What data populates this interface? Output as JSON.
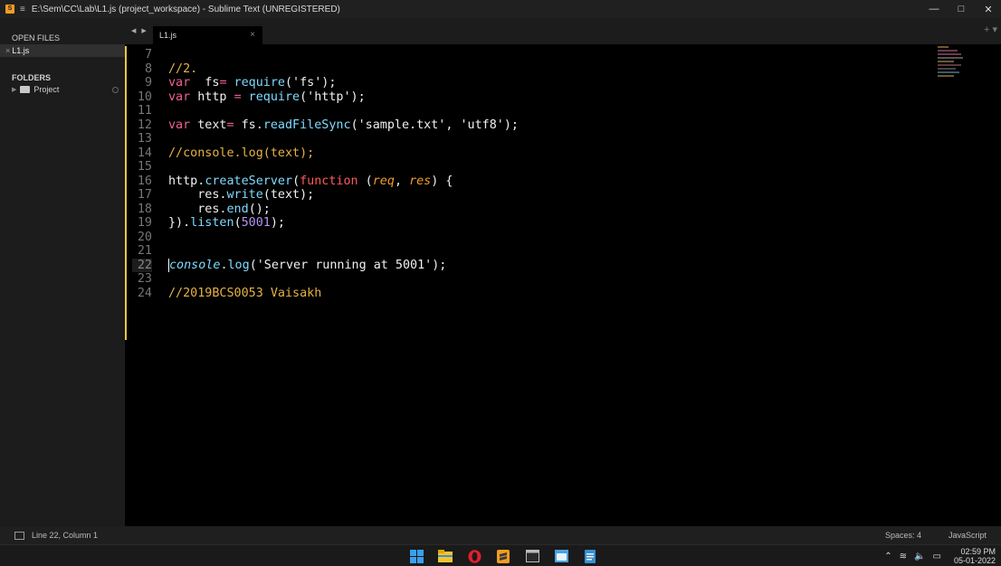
{
  "window": {
    "title": "E:\\Sem\\CC\\Lab\\L1.js (project_workspace) - Sublime Text (UNREGISTERED)",
    "controls": [
      "—",
      "□",
      "✕"
    ]
  },
  "sidebar": {
    "open_files_label": "OPEN FILES",
    "open_file": "L1.js",
    "folders_label": "FOLDERS",
    "project": "Project"
  },
  "tabs": {
    "active": "L1.js",
    "close": "×",
    "nav": "◀ ▶",
    "plus": "+ ▾"
  },
  "editor": {
    "lines": [
      {
        "n": "7"
      },
      {
        "n": "8"
      },
      {
        "n": "9"
      },
      {
        "n": "10"
      },
      {
        "n": "11"
      },
      {
        "n": "12"
      },
      {
        "n": "13"
      },
      {
        "n": "14"
      },
      {
        "n": "15"
      },
      {
        "n": "16"
      },
      {
        "n": "17"
      },
      {
        "n": "18"
      },
      {
        "n": "19"
      },
      {
        "n": "20"
      },
      {
        "n": "21"
      },
      {
        "n": "22"
      },
      {
        "n": "23"
      },
      {
        "n": "24"
      }
    ],
    "code": {
      "l8": "//2.",
      "l9_kw": "var",
      "l9_a": "  fs",
      "l9_eq": "=",
      "l9_fn": " require",
      "l9_b": "('fs');",
      "l10_kw": "var",
      "l10_a": " http ",
      "l10_eq": "=",
      "l10_fn": " require",
      "l10_b": "('http');",
      "l12_kw": "var",
      "l12_a": " text",
      "l12_eq": "=",
      "l12_b": " fs.",
      "l12_fn": "readFileSync",
      "l12_c": "('sample.txt', 'utf8');",
      "l14": "//console.log(text);",
      "l16_a": "http.",
      "l16_fn": "createServer",
      "l16_b": "(",
      "l16_fkw": "function",
      "l16_c": " (",
      "l16_p1": "req",
      "l16_d": ", ",
      "l16_p2": "res",
      "l16_e": ") {",
      "l17_a": "    res.",
      "l17_fn": "write",
      "l17_b": "(text);",
      "l18_a": "    res.",
      "l18_fn": "end",
      "l18_b": "();",
      "l19_a": "}).",
      "l19_fn": "listen",
      "l19_b": "(",
      "l19_num": "5001",
      "l19_c": ");",
      "l22_con": "console",
      "l22_a": ".",
      "l22_fn": "log",
      "l22_b": "('Server running at 5001');",
      "l24": "//2019BCS0053 Vaisakh"
    }
  },
  "statusbar": {
    "position": "Line 22, Column 1",
    "spaces": "Spaces: 4",
    "syntax": "JavaScript"
  },
  "taskbar": {
    "time": "02:59 PM",
    "date": "05-01-2022"
  },
  "colors": {
    "accent": "#e7c547",
    "comment": "#e6b243",
    "keyword": "#f06292",
    "function": "#7fdbff",
    "number": "#b794f6"
  }
}
